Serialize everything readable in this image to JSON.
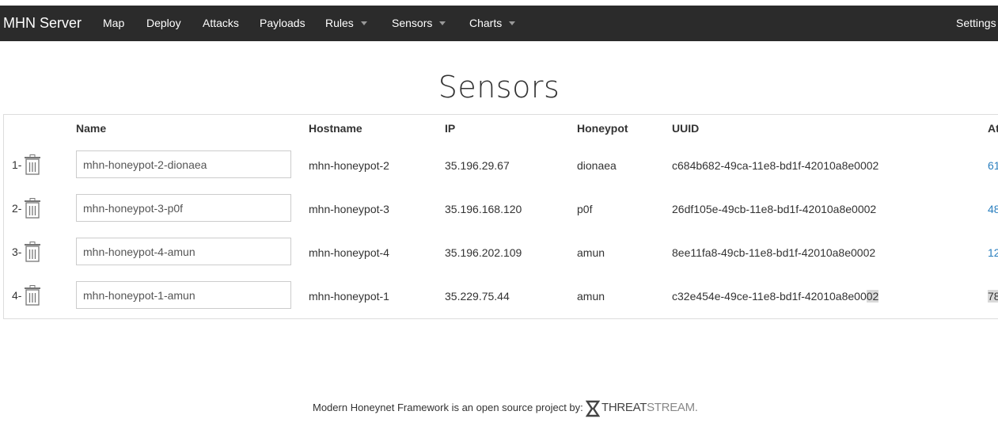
{
  "navbar": {
    "brand": "MHN Server",
    "items": [
      {
        "label": "Map"
      },
      {
        "label": "Deploy"
      },
      {
        "label": "Attacks"
      },
      {
        "label": "Payloads"
      },
      {
        "label": "Rules"
      },
      {
        "label": "Sensors"
      },
      {
        "label": "Charts"
      }
    ],
    "settings": "Settings"
  },
  "page": {
    "title": "Sensors"
  },
  "table": {
    "headers": [
      "Name",
      "Hostname",
      "IP",
      "Honeypot",
      "UUID",
      "At"
    ],
    "rows": [
      {
        "index": "1-",
        "name": "mhn-honeypot-2-dionaea",
        "hostname": "mhn-honeypot-2",
        "ip": "35.196.29.67",
        "honeypot": "dionaea",
        "uuid": "c684b682-49ca-11e8-bd1f-42010a8e0002",
        "attacks": "61"
      },
      {
        "index": "2-",
        "name": "mhn-honeypot-3-p0f",
        "hostname": "mhn-honeypot-3",
        "ip": "35.196.168.120",
        "honeypot": "p0f",
        "uuid": "26df105e-49cb-11e8-bd1f-42010a8e0002",
        "attacks": "48"
      },
      {
        "index": "3-",
        "name": "mhn-honeypot-4-amun",
        "hostname": "mhn-honeypot-4",
        "ip": "35.196.202.109",
        "honeypot": "amun",
        "uuid": "8ee11fa8-49cb-11e8-bd1f-42010a8e0002",
        "attacks": "12"
      },
      {
        "index": "4-",
        "name": "mhn-honeypot-1-amun",
        "hostname": "mhn-honeypot-1",
        "ip": "35.229.75.44",
        "honeypot": "amun",
        "uuid_main": "c32e454e-49ce-11e8-bd1f-42010a8e00",
        "uuid_selected": "02",
        "attacks": "78"
      }
    ]
  },
  "footer": {
    "text": "Modern Honeynet Framework is an open source project by:",
    "logo_bold": "THREAT",
    "logo_light": "STREAM."
  },
  "colors": {
    "navbar": "#2b2b2b",
    "link": "#2a7fbf",
    "selection": "#d9d9d9"
  },
  "icons": {
    "delete": "trash-icon",
    "logo": "threatstream-logo-icon"
  }
}
